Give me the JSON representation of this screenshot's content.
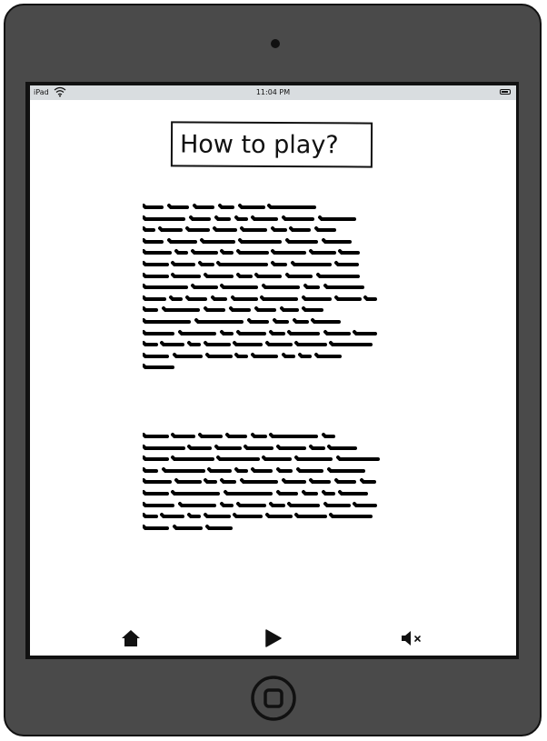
{
  "status_bar": {
    "carrier": "iPad",
    "time": "11:04 PM"
  },
  "page": {
    "title": "How to play?"
  },
  "icons": {
    "home": "home-icon",
    "play": "play-icon",
    "mute": "mute-icon",
    "wifi": "wifi-icon",
    "battery": "battery-icon"
  }
}
